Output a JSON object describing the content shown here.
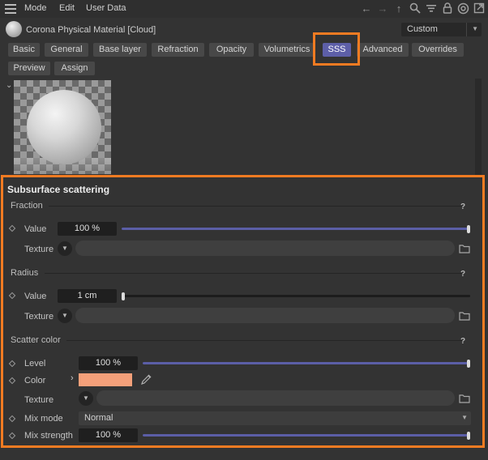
{
  "menu": {
    "items": [
      "Mode",
      "Edit",
      "User Data"
    ]
  },
  "toolbar_icons": [
    "back-arrow-icon",
    "forward-arrow-icon",
    "up-arrow-icon",
    "search-icon",
    "filter-icon",
    "lock-icon",
    "target-icon",
    "new-window-icon"
  ],
  "header": {
    "material_title": "Corona Physical Material [Cloud]",
    "preset_value": "Custom"
  },
  "tabs": [
    {
      "label": "Basic"
    },
    {
      "label": "General"
    },
    {
      "label": "Base layer"
    },
    {
      "label": "Refraction"
    },
    {
      "label": "Opacity"
    },
    {
      "label": "Volumetrics"
    },
    {
      "label": "SSS",
      "active": true
    },
    {
      "label": "Advanced"
    },
    {
      "label": "Overrides"
    },
    {
      "label": "Preview"
    },
    {
      "label": "Assign"
    }
  ],
  "section": {
    "title": "Subsurface scattering",
    "fraction": {
      "title": "Fraction",
      "help": "?",
      "value_label": "Value",
      "value": "100 %",
      "value_level": 1.0,
      "texture_label": "Texture"
    },
    "radius": {
      "title": "Radius",
      "help": "?",
      "value_label": "Value",
      "value": "1 cm",
      "value_level": 0.0,
      "texture_label": "Texture"
    },
    "scatter_color": {
      "title": "Scatter color",
      "help": "?",
      "level_label": "Level",
      "level_value": "100 %",
      "level_level": 1.0,
      "color_label": "Color",
      "color_hex": "#f4a07a",
      "texture_label": "Texture",
      "mix_mode_label": "Mix mode",
      "mix_mode_value": "Normal",
      "mix_strength_label": "Mix strength",
      "mix_strength_value": "100 %",
      "mix_strength_level": 1.0
    }
  },
  "colors": {
    "accent": "#5b5ea6",
    "highlight": "#f27b22"
  }
}
